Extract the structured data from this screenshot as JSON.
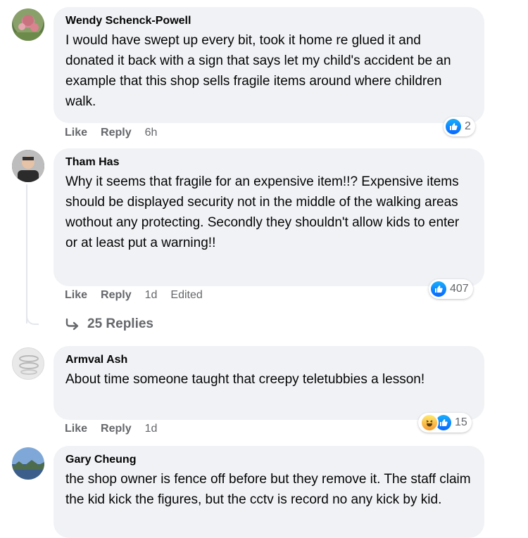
{
  "comments": [
    {
      "author": "Wendy Schenck-Powell",
      "text": "I would have swept up every bit, took it home re glued it and donated it back with a sign that says let my child's accident be an example that this shop sells fragile items around where children walk.",
      "like_label": "Like",
      "reply_label": "Reply",
      "time": "6h",
      "reaction_count": "2"
    },
    {
      "author": "Tham Has",
      "text": "Why it seems that fragile for an expensive item!!? Expensive items should be displayed security not in the middle of the walking areas wothout any protecting. Secondly they shouldn't allow kids to enter or at least put a warning!!",
      "like_label": "Like",
      "reply_label": "Reply",
      "time": "1d",
      "edited": "Edited",
      "reaction_count": "407",
      "replies_label": "25 Replies"
    },
    {
      "author": "Armval Ash",
      "text": "About time someone taught that creepy teletubbies a lesson!",
      "like_label": "Like",
      "reply_label": "Reply",
      "time": "1d",
      "reaction_count": "15"
    },
    {
      "author": "Gary Cheung",
      "text": "the shop owner is fence off before but they remove it. The staff claim the kid kick the figures, but the cctv is record no any kick by kid."
    }
  ],
  "colors": {
    "bubble": "#f0f2f5",
    "meta_text": "#65676b",
    "like_blue": "#0866ff"
  }
}
